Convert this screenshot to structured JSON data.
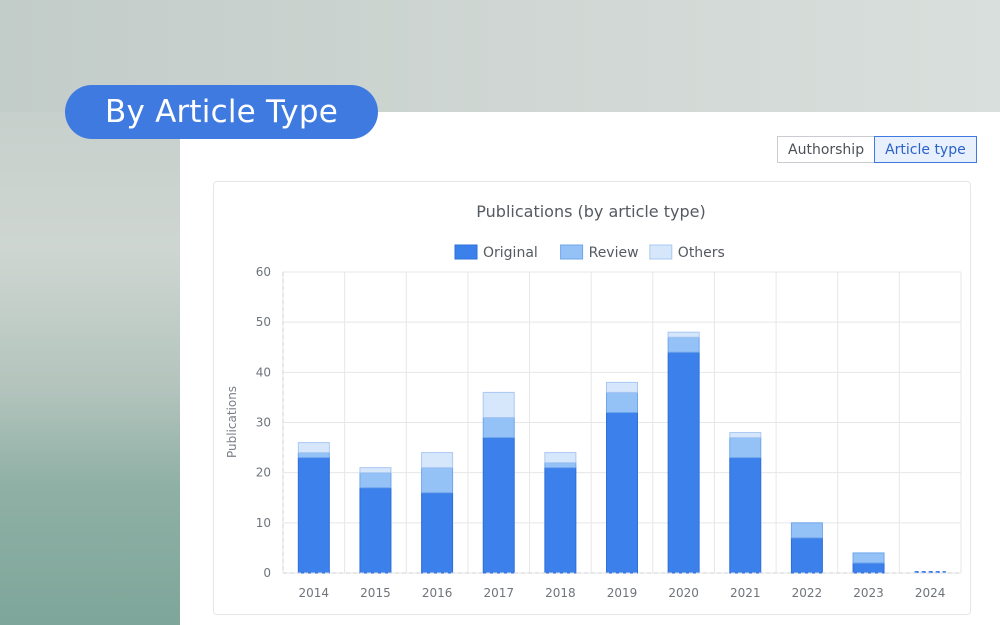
{
  "header": {
    "pill_label": "By Article Type"
  },
  "toggle": {
    "authorship_label": "Authorship",
    "article_type_label": "Article type"
  },
  "colors": {
    "original": "#3c80ec",
    "review": "#94c2f7",
    "others": "#d7e7fb",
    "accent": "#3f7ae0"
  },
  "chart_data": {
    "type": "bar",
    "stacked": true,
    "title": "Publications (by article type)",
    "ylabel": "Publications",
    "xlabel": "",
    "ylim": [
      0,
      60
    ],
    "yticks": [
      0,
      10,
      20,
      30,
      40,
      50,
      60
    ],
    "grid": true,
    "legend": "top-center",
    "categories": [
      "2014",
      "2015",
      "2016",
      "2017",
      "2018",
      "2019",
      "2020",
      "2021",
      "2022",
      "2023",
      "2024"
    ],
    "series": [
      {
        "name": "Original",
        "values": [
          23,
          17,
          16,
          27,
          21,
          32,
          44,
          23,
          7,
          2,
          0
        ]
      },
      {
        "name": "Review",
        "values": [
          1,
          3,
          5,
          4,
          1,
          4,
          3,
          4,
          3,
          2,
          0
        ]
      },
      {
        "name": "Others",
        "values": [
          2,
          1,
          3,
          5,
          2,
          2,
          1,
          1,
          0,
          0,
          0
        ]
      }
    ]
  }
}
